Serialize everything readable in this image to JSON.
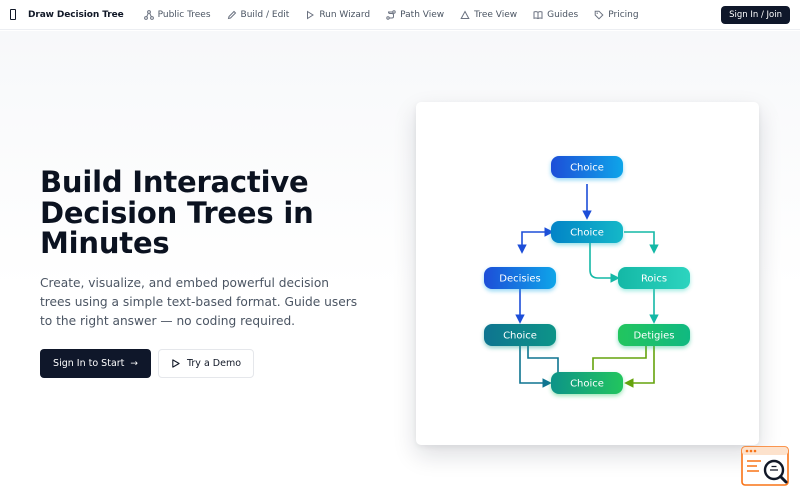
{
  "nav": {
    "brand_icon": "phone-outline-icon",
    "brand": "Draw Decision Tree",
    "links": [
      {
        "label": "Public Trees",
        "icon": "network-icon"
      },
      {
        "label": "Build / Edit",
        "icon": "pencil-icon"
      },
      {
        "label": "Run Wizard",
        "icon": "play-icon"
      },
      {
        "label": "Path View",
        "icon": "route-icon"
      },
      {
        "label": "Tree View",
        "icon": "triangle-icon"
      },
      {
        "label": "Guides",
        "icon": "book-icon"
      },
      {
        "label": "Pricing",
        "icon": "tag-icon"
      }
    ],
    "signin": "Sign In / Join"
  },
  "hero": {
    "title": "Build Interactive Decision Trees in Minutes",
    "subtitle": "Create, visualize, and embed powerful decision trees using a simple text-based format. Guide users to the right answer — no coding required.",
    "primary_button": "Sign In to Start",
    "secondary_button": "Try a Demo"
  },
  "preview": {
    "nodes": [
      {
        "id": "n1",
        "label": "Choice",
        "colors": [
          "#1d4ed8",
          "#0ea5e9"
        ]
      },
      {
        "id": "n2",
        "label": "Choice",
        "colors": [
          "#0284c7",
          "#14b8c8"
        ]
      },
      {
        "id": "n3",
        "label": "Decisies",
        "colors": [
          "#1d4ed8",
          "#0ea5e9"
        ]
      },
      {
        "id": "n4",
        "label": "Roics",
        "colors": [
          "#14b8a6",
          "#2dd4bf"
        ]
      },
      {
        "id": "n5",
        "label": "Choice",
        "colors": [
          "#0e7490",
          "#0d9488"
        ]
      },
      {
        "id": "n6",
        "label": "Detigies",
        "colors": [
          "#22c55e",
          "#10b981"
        ]
      },
      {
        "id": "n7",
        "label": "Choice",
        "colors": [
          "#0d9488",
          "#22c55e"
        ]
      }
    ]
  },
  "widget": {
    "icon": "search-window-icon",
    "accent": "#f97316"
  }
}
